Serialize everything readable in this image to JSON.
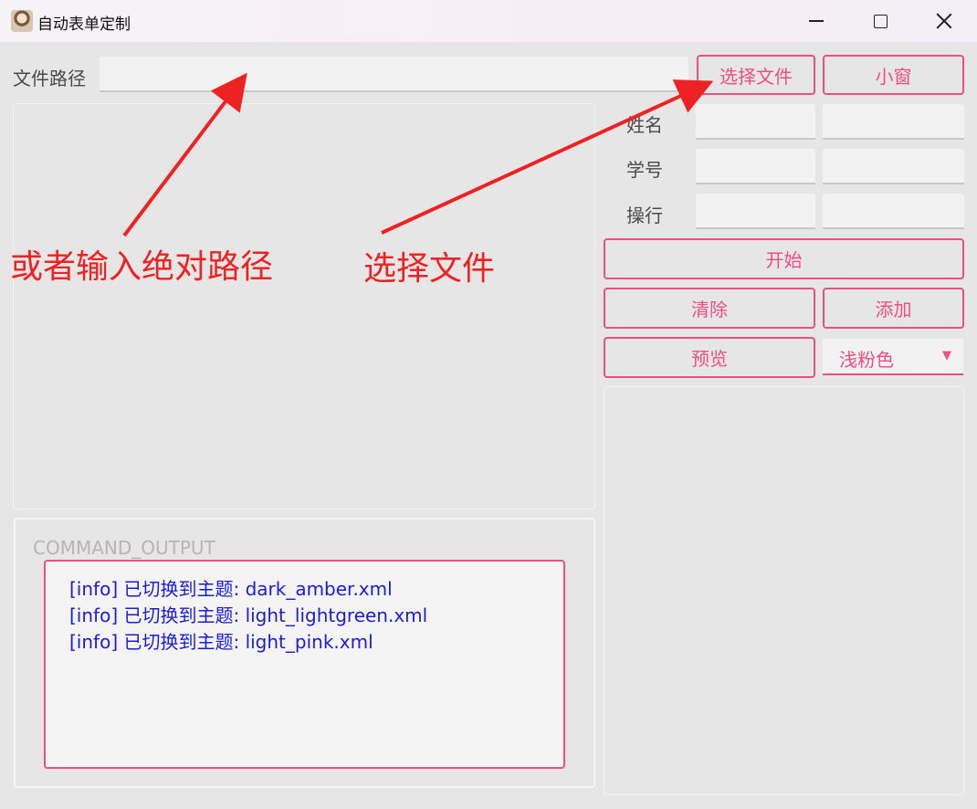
{
  "window": {
    "title": "自动表单定制"
  },
  "file_path": {
    "label": "文件路径",
    "value": ""
  },
  "buttons": {
    "choose_file": "选择文件",
    "small_window": "小窗",
    "start": "开始",
    "clear": "清除",
    "add": "添加",
    "preview": "预览"
  },
  "form": {
    "rows": [
      {
        "label": "姓名"
      },
      {
        "label": "学号"
      },
      {
        "label": "操行"
      }
    ]
  },
  "theme_select": {
    "selected": "浅粉色"
  },
  "command_output": {
    "title": "COMMAND_OUTPUT",
    "lines": [
      "[info] 已切换到主题: dark_amber.xml",
      "[info] 已切换到主题: light_lightgreen.xml",
      "[info] 已切换到主题: light_pink.xml"
    ]
  },
  "annotations": {
    "left_text": "或者输入绝对路径",
    "right_text": "选择文件",
    "color": "#ee2222"
  },
  "colors": {
    "accent": "#ef4d83",
    "log_text": "#1c1cd6",
    "annotation": "#ee2222"
  },
  "icons": {
    "app": "app-avatar-icon",
    "minimize": "minimize-icon",
    "maximize": "maximize-icon",
    "close": "close-icon",
    "dropdown": "dropdown-arrow-icon"
  }
}
